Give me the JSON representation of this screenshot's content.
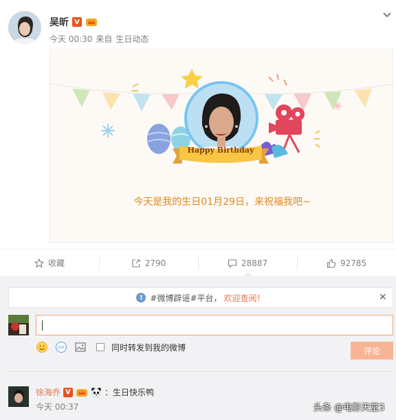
{
  "post": {
    "author": "吴昕",
    "verified_badge": "V",
    "time": "今天 00:30",
    "source_prefix": "来自",
    "source": "生日动态",
    "card": {
      "banner_text": "Happy Birthday",
      "message": "今天是我的生日01月29日，来祝福我吧~"
    }
  },
  "actions": {
    "favorite": "收藏",
    "repost": "2790",
    "comment": "28887",
    "like": "92785"
  },
  "comments": {
    "notice_prefix": "#微博辟谣#平台，",
    "notice_link": "欢迎查阅！",
    "close": "×",
    "input_value": "",
    "repost_checkbox_label": "同时转发到我的微博",
    "submit_label": "评论",
    "items": [
      {
        "name": "徐海乔",
        "badge": "V",
        "text": "：生日快乐鸭",
        "time": "今天 00:37"
      }
    ]
  },
  "watermark": "头条 @电影天堂3",
  "colors": {
    "accent": "#eb7350",
    "card_text": "#e28918",
    "submit_bg": "#f8b596"
  }
}
